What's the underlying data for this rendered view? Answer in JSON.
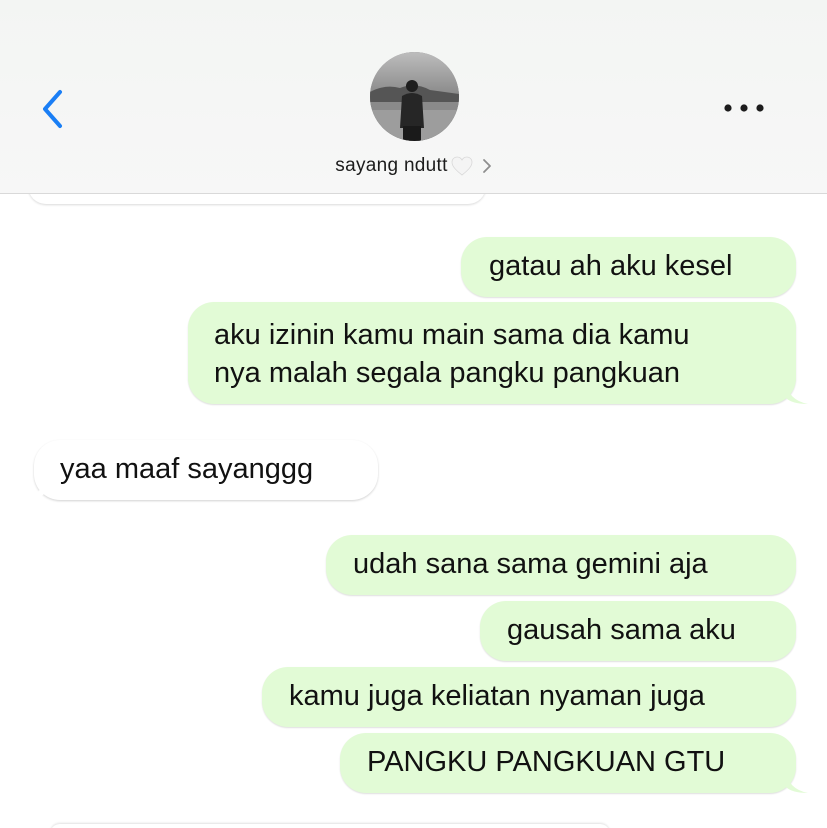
{
  "header": {
    "contact_name": "sayang ndutt",
    "back_icon": "chevron-left-icon",
    "more_icon": "ellipsis-icon",
    "accent_color": "#1a7ef5"
  },
  "messages": [
    {
      "direction": "outgoing",
      "lines": [
        "gatau ah aku kesel"
      ]
    },
    {
      "direction": "outgoing",
      "lines": [
        "aku izinin kamu main sama dia kamu",
        "nya malah segala pangku pangkuan"
      ]
    },
    {
      "direction": "incoming",
      "lines": [
        "yaa maaf sayanggg"
      ]
    },
    {
      "direction": "outgoing",
      "lines": [
        "udah sana sama gemini aja"
      ]
    },
    {
      "direction": "outgoing",
      "lines": [
        "gausah sama aku"
      ]
    },
    {
      "direction": "outgoing",
      "lines": [
        "kamu juga keliatan nyaman juga"
      ]
    },
    {
      "direction": "outgoing",
      "lines": [
        "PANGKU PANGKUAN GTU"
      ]
    }
  ],
  "colors": {
    "outgoing_bubble": "#e2fbd6",
    "incoming_bubble": "#ffffff"
  }
}
